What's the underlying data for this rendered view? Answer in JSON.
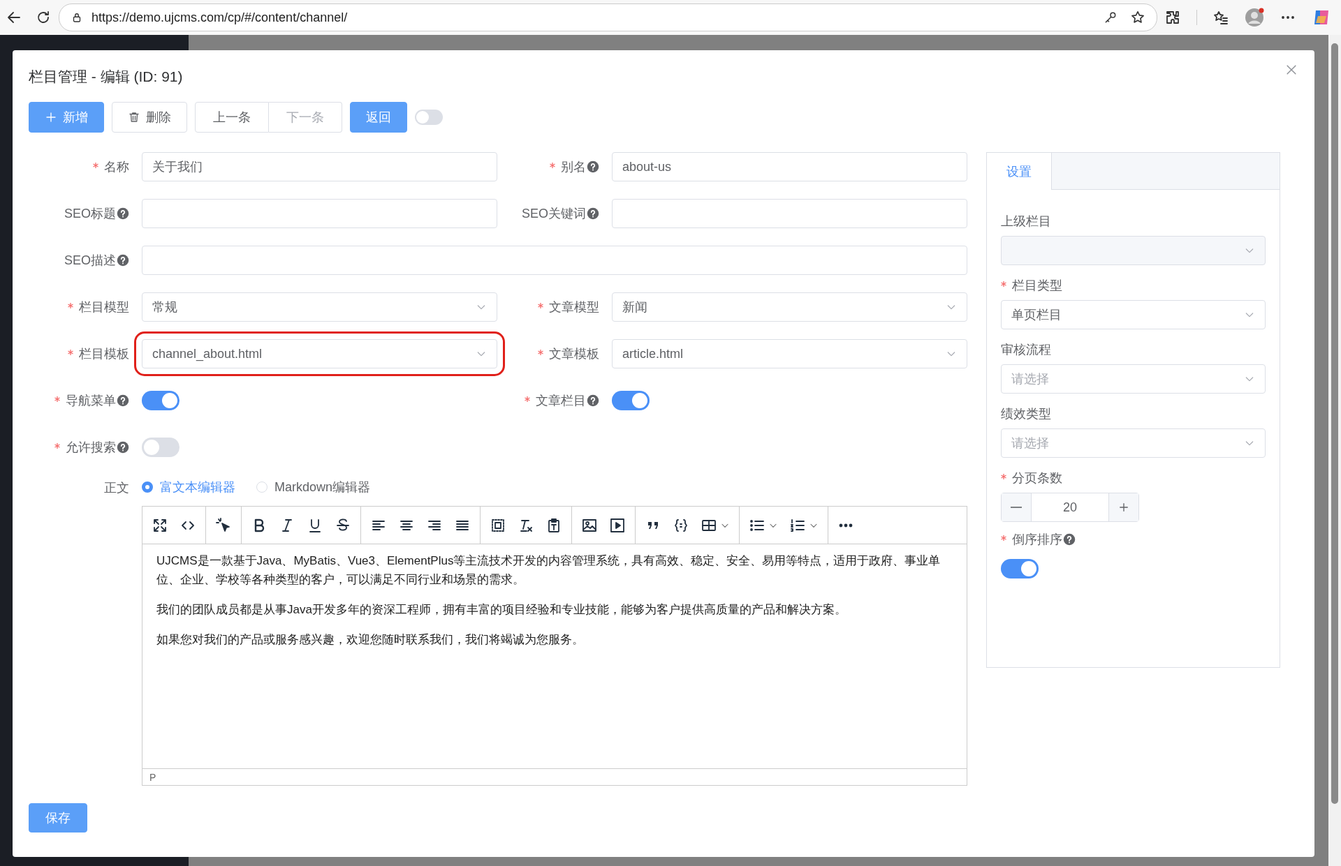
{
  "browser": {
    "url": "https://demo.ujcms.com/cp/#/content/channel/"
  },
  "dialog": {
    "title": "栏目管理 - 编辑 (ID: 91)"
  },
  "toolbar": {
    "buttons": [
      {
        "label": "新增",
        "kind": "primary",
        "disabled": false
      },
      {
        "label": "删除",
        "kind": "default",
        "disabled": false
      },
      {
        "label": "上一条",
        "kind": "group",
        "disabled": false
      },
      {
        "label": "下一条",
        "kind": "group",
        "disabled": true
      },
      {
        "label": "返回",
        "kind": "primary",
        "disabled": false
      }
    ],
    "toggle": {
      "on": false
    }
  },
  "form": {
    "fields": [
      {
        "label": "名称",
        "kind": "text",
        "required": true,
        "help": false,
        "value": "关于我们"
      },
      {
        "label": "别名",
        "kind": "text",
        "required": true,
        "help": true,
        "value": "about-us"
      },
      {
        "label": "SEO标题",
        "kind": "text",
        "required": false,
        "help": true
      },
      {
        "label": "SEO关键词",
        "kind": "text",
        "required": false,
        "help": true
      },
      {
        "label": "SEO描述",
        "kind": "text",
        "required": false,
        "help": true,
        "wide": true
      },
      {
        "label": "栏目模型",
        "kind": "select",
        "required": true,
        "help": false,
        "value": "常规"
      },
      {
        "label": "文章模型",
        "kind": "select",
        "required": true,
        "help": false,
        "value": "新闻"
      },
      {
        "label": "栏目模板",
        "kind": "select",
        "required": true,
        "help": false,
        "value": "channel_about.html",
        "highlighted": true
      },
      {
        "label": "文章模板",
        "kind": "select",
        "required": true,
        "help": false,
        "value": "article.html"
      },
      {
        "label": "导航菜单",
        "kind": "switch",
        "required": true,
        "help": true,
        "on": true
      },
      {
        "label": "文章栏目",
        "kind": "switch",
        "required": true,
        "help": true,
        "on": true
      },
      {
        "label": "允许搜索",
        "kind": "switch",
        "required": true,
        "help": true,
        "on": false
      }
    ],
    "content": {
      "label": "正文",
      "editors": [
        {
          "label": "富文本编辑器",
          "selected": true
        },
        {
          "label": "Markdown编辑器",
          "selected": false
        }
      ],
      "paragraphs": [
        "UJCMS是一款基于Java、MyBatis、Vue3、ElementPlus等主流技术开发的内容管理系统，具有高效、稳定、安全、易用等特点，适用于政府、事业单位、企业、学校等各种类型的客户，可以满足不同行业和场景的需求。",
        "我们的团队成员都是从事Java开发多年的资深工程师，拥有丰富的项目经验和专业技能，能够为客户提供高质量的产品和解决方案。",
        "如果您对我们的产品或服务感兴趣，欢迎您随时联系我们，我们将竭诚为您服务。"
      ],
      "path": "P"
    },
    "save": "保存"
  },
  "settings": {
    "tabs": [
      {
        "label": "设置",
        "selected": true
      }
    ],
    "fields": [
      {
        "label": "上级栏目",
        "kind": "select",
        "required": false,
        "help": false,
        "disabled": true
      },
      {
        "label": "栏目类型",
        "kind": "select",
        "required": true,
        "help": false,
        "value": "单页栏目"
      },
      {
        "label": "审核流程",
        "kind": "select",
        "required": false,
        "help": false,
        "placeholder": "请选择"
      },
      {
        "label": "绩效类型",
        "kind": "select",
        "required": false,
        "help": false,
        "placeholder": "请选择"
      },
      {
        "label": "分页条数",
        "kind": "number",
        "required": true,
        "help": false,
        "value": "20"
      },
      {
        "label": "倒序排序",
        "kind": "switch",
        "required": true,
        "help": true,
        "on": true
      }
    ]
  }
}
